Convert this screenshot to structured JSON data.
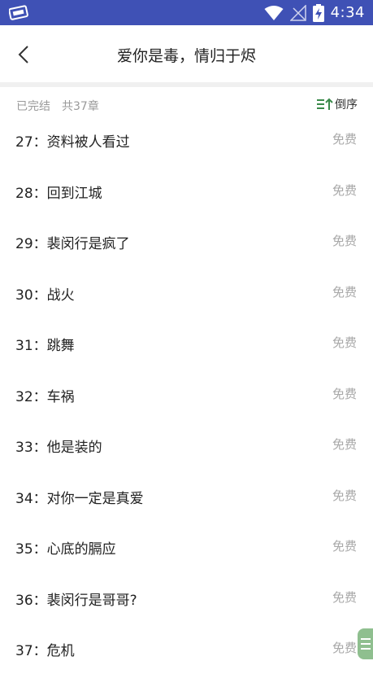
{
  "status_bar": {
    "time": "4:34",
    "icons": [
      "app-notification-icon",
      "wifi-icon",
      "signal-icon",
      "battery-charging-icon"
    ],
    "background": "#3f51b5"
  },
  "header": {
    "back_icon": "chevron-left-icon",
    "title": "爱你是毒，情归于烬"
  },
  "info": {
    "status": "已完结",
    "chapter_count": "共37章",
    "sort_label": "倒序",
    "sort_icon": "sort-desc-icon",
    "accent": "#3a8a4a"
  },
  "chapters": [
    {
      "title": "27：资料被人看过",
      "price": "免费"
    },
    {
      "title": "28：回到江城",
      "price": "免费"
    },
    {
      "title": "29：裴闵行是疯了",
      "price": "免费"
    },
    {
      "title": "30：战火",
      "price": "免费"
    },
    {
      "title": "31：跳舞",
      "price": "免费"
    },
    {
      "title": "32：车祸",
      "price": "免费"
    },
    {
      "title": "33：他是装的",
      "price": "免费"
    },
    {
      "title": "34：对你一定是真爱",
      "price": "免费"
    },
    {
      "title": "35：心底的膈应",
      "price": "免费"
    },
    {
      "title": "36：裴闵行是哥哥?",
      "price": "免费"
    },
    {
      "title": "37：危机",
      "price": "免费"
    }
  ]
}
